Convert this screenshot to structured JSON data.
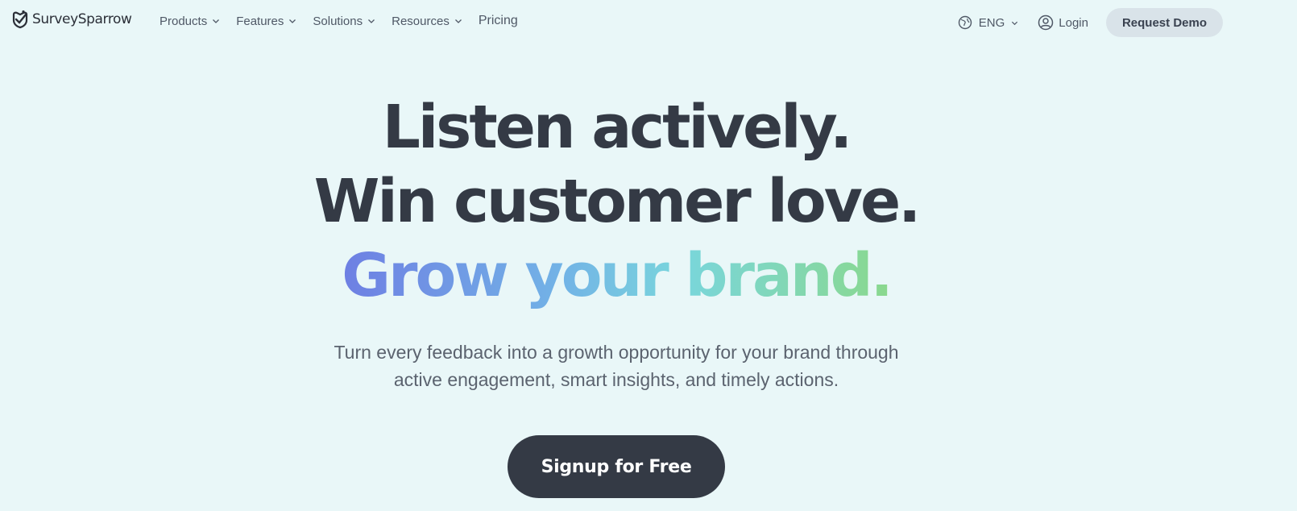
{
  "brand": {
    "name": "SurveySparrow"
  },
  "nav": {
    "items": [
      {
        "label": "Products",
        "has_dropdown": true
      },
      {
        "label": "Features",
        "has_dropdown": true
      },
      {
        "label": "Solutions",
        "has_dropdown": true
      },
      {
        "label": "Resources",
        "has_dropdown": true
      },
      {
        "label": "Pricing",
        "has_dropdown": false
      }
    ],
    "language": "ENG",
    "login": "Login",
    "demo": "Request Demo"
  },
  "hero": {
    "line1": "Listen actively.",
    "line2": "Win customer love.",
    "line3": "Grow your brand.",
    "subtitle_line1": "Turn every feedback into a growth opportunity for your brand through",
    "subtitle_line2": "active engagement, smart insights, and timely actions.",
    "cta": "Signup for Free"
  },
  "colors": {
    "background": "#e9f7f8",
    "text_dark": "#343a45",
    "cta_bg": "#343a45",
    "demo_bg": "#d9e3e9",
    "gradient": [
      "#6e7fe3",
      "#72b3e6",
      "#79d6dc",
      "#8ad88d"
    ]
  },
  "icons": {
    "logo": "sparrow-logo-icon",
    "dropdown": "chevron-down-icon",
    "language": "globe-icon",
    "login": "user-circle-icon"
  }
}
